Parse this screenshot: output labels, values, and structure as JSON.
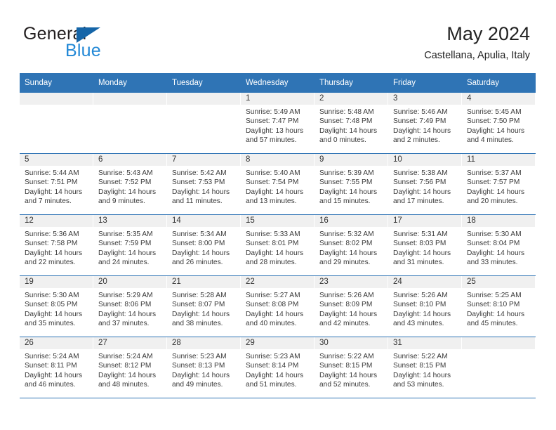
{
  "brand": {
    "word_one": "General",
    "word_two": "Blue",
    "triangle_color": "#1565a8",
    "blue_color": "#2288d6"
  },
  "header": {
    "title": "May 2024",
    "subtitle": "Castellana, Apulia, Italy",
    "header_bg": "#2f74b5"
  },
  "weekdays": [
    "Sunday",
    "Monday",
    "Tuesday",
    "Wednesday",
    "Thursday",
    "Friday",
    "Saturday"
  ],
  "labels": {
    "sunrise": "Sunrise:",
    "sunset": "Sunset:",
    "daylight": "Daylight:"
  },
  "weeks": [
    [
      {
        "day": "",
        "empty": true
      },
      {
        "day": "",
        "empty": true
      },
      {
        "day": "",
        "empty": true
      },
      {
        "day": "1",
        "sunrise": "Sunrise: 5:49 AM",
        "sunset": "Sunset: 7:47 PM",
        "daylight": "Daylight: 13 hours and 57 minutes."
      },
      {
        "day": "2",
        "sunrise": "Sunrise: 5:48 AM",
        "sunset": "Sunset: 7:48 PM",
        "daylight": "Daylight: 14 hours and 0 minutes."
      },
      {
        "day": "3",
        "sunrise": "Sunrise: 5:46 AM",
        "sunset": "Sunset: 7:49 PM",
        "daylight": "Daylight: 14 hours and 2 minutes."
      },
      {
        "day": "4",
        "sunrise": "Sunrise: 5:45 AM",
        "sunset": "Sunset: 7:50 PM",
        "daylight": "Daylight: 14 hours and 4 minutes."
      }
    ],
    [
      {
        "day": "5",
        "sunrise": "Sunrise: 5:44 AM",
        "sunset": "Sunset: 7:51 PM",
        "daylight": "Daylight: 14 hours and 7 minutes."
      },
      {
        "day": "6",
        "sunrise": "Sunrise: 5:43 AM",
        "sunset": "Sunset: 7:52 PM",
        "daylight": "Daylight: 14 hours and 9 minutes."
      },
      {
        "day": "7",
        "sunrise": "Sunrise: 5:42 AM",
        "sunset": "Sunset: 7:53 PM",
        "daylight": "Daylight: 14 hours and 11 minutes."
      },
      {
        "day": "8",
        "sunrise": "Sunrise: 5:40 AM",
        "sunset": "Sunset: 7:54 PM",
        "daylight": "Daylight: 14 hours and 13 minutes."
      },
      {
        "day": "9",
        "sunrise": "Sunrise: 5:39 AM",
        "sunset": "Sunset: 7:55 PM",
        "daylight": "Daylight: 14 hours and 15 minutes."
      },
      {
        "day": "10",
        "sunrise": "Sunrise: 5:38 AM",
        "sunset": "Sunset: 7:56 PM",
        "daylight": "Daylight: 14 hours and 17 minutes."
      },
      {
        "day": "11",
        "sunrise": "Sunrise: 5:37 AM",
        "sunset": "Sunset: 7:57 PM",
        "daylight": "Daylight: 14 hours and 20 minutes."
      }
    ],
    [
      {
        "day": "12",
        "sunrise": "Sunrise: 5:36 AM",
        "sunset": "Sunset: 7:58 PM",
        "daylight": "Daylight: 14 hours and 22 minutes."
      },
      {
        "day": "13",
        "sunrise": "Sunrise: 5:35 AM",
        "sunset": "Sunset: 7:59 PM",
        "daylight": "Daylight: 14 hours and 24 minutes."
      },
      {
        "day": "14",
        "sunrise": "Sunrise: 5:34 AM",
        "sunset": "Sunset: 8:00 PM",
        "daylight": "Daylight: 14 hours and 26 minutes."
      },
      {
        "day": "15",
        "sunrise": "Sunrise: 5:33 AM",
        "sunset": "Sunset: 8:01 PM",
        "daylight": "Daylight: 14 hours and 28 minutes."
      },
      {
        "day": "16",
        "sunrise": "Sunrise: 5:32 AM",
        "sunset": "Sunset: 8:02 PM",
        "daylight": "Daylight: 14 hours and 29 minutes."
      },
      {
        "day": "17",
        "sunrise": "Sunrise: 5:31 AM",
        "sunset": "Sunset: 8:03 PM",
        "daylight": "Daylight: 14 hours and 31 minutes."
      },
      {
        "day": "18",
        "sunrise": "Sunrise: 5:30 AM",
        "sunset": "Sunset: 8:04 PM",
        "daylight": "Daylight: 14 hours and 33 minutes."
      }
    ],
    [
      {
        "day": "19",
        "sunrise": "Sunrise: 5:30 AM",
        "sunset": "Sunset: 8:05 PM",
        "daylight": "Daylight: 14 hours and 35 minutes."
      },
      {
        "day": "20",
        "sunrise": "Sunrise: 5:29 AM",
        "sunset": "Sunset: 8:06 PM",
        "daylight": "Daylight: 14 hours and 37 minutes."
      },
      {
        "day": "21",
        "sunrise": "Sunrise: 5:28 AM",
        "sunset": "Sunset: 8:07 PM",
        "daylight": "Daylight: 14 hours and 38 minutes."
      },
      {
        "day": "22",
        "sunrise": "Sunrise: 5:27 AM",
        "sunset": "Sunset: 8:08 PM",
        "daylight": "Daylight: 14 hours and 40 minutes."
      },
      {
        "day": "23",
        "sunrise": "Sunrise: 5:26 AM",
        "sunset": "Sunset: 8:09 PM",
        "daylight": "Daylight: 14 hours and 42 minutes."
      },
      {
        "day": "24",
        "sunrise": "Sunrise: 5:26 AM",
        "sunset": "Sunset: 8:10 PM",
        "daylight": "Daylight: 14 hours and 43 minutes."
      },
      {
        "day": "25",
        "sunrise": "Sunrise: 5:25 AM",
        "sunset": "Sunset: 8:10 PM",
        "daylight": "Daylight: 14 hours and 45 minutes."
      }
    ],
    [
      {
        "day": "26",
        "sunrise": "Sunrise: 5:24 AM",
        "sunset": "Sunset: 8:11 PM",
        "daylight": "Daylight: 14 hours and 46 minutes."
      },
      {
        "day": "27",
        "sunrise": "Sunrise: 5:24 AM",
        "sunset": "Sunset: 8:12 PM",
        "daylight": "Daylight: 14 hours and 48 minutes."
      },
      {
        "day": "28",
        "sunrise": "Sunrise: 5:23 AM",
        "sunset": "Sunset: 8:13 PM",
        "daylight": "Daylight: 14 hours and 49 minutes."
      },
      {
        "day": "29",
        "sunrise": "Sunrise: 5:23 AM",
        "sunset": "Sunset: 8:14 PM",
        "daylight": "Daylight: 14 hours and 51 minutes."
      },
      {
        "day": "30",
        "sunrise": "Sunrise: 5:22 AM",
        "sunset": "Sunset: 8:15 PM",
        "daylight": "Daylight: 14 hours and 52 minutes."
      },
      {
        "day": "31",
        "sunrise": "Sunrise: 5:22 AM",
        "sunset": "Sunset: 8:15 PM",
        "daylight": "Daylight: 14 hours and 53 minutes."
      },
      {
        "day": "",
        "empty": true
      }
    ]
  ]
}
